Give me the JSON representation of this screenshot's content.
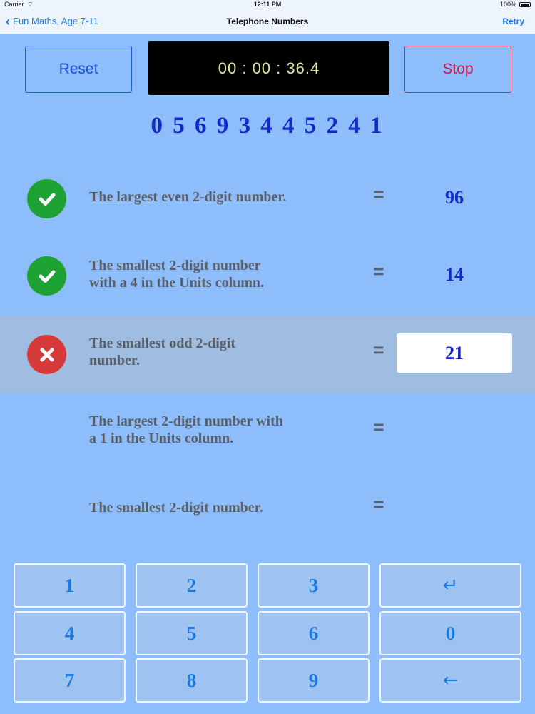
{
  "status_bar": {
    "carrier": "Carrier",
    "time": "12:11 PM",
    "battery": "100%"
  },
  "nav": {
    "back_label": "Fun Maths, Age 7-11",
    "title": "Telephone Numbers",
    "right_label": "Retry"
  },
  "controls": {
    "reset_label": "Reset",
    "stop_label": "Stop",
    "timer": "00 : 00 : 36.4"
  },
  "phone_number": "0 5 6 9 3 4 4 5 2 4 1",
  "questions": [
    {
      "line1": "The largest even 2-digit number.",
      "line2": "",
      "equals": "=",
      "answer": "96",
      "status": "correct"
    },
    {
      "line1": "The smallest 2-digit number",
      "line2": "with a 4 in the Units column.",
      "equals": "=",
      "answer": "14",
      "status": "correct"
    },
    {
      "line1": "The smallest odd 2-digit",
      "line2": "number.",
      "equals": "=",
      "answer": "21",
      "status": "wrong"
    },
    {
      "line1": "The largest 2-digit number with",
      "line2": "a 1 in the Units column.",
      "equals": "=",
      "answer": "",
      "status": "pending"
    },
    {
      "line1": "The smallest 2-digit number.",
      "line2": "",
      "equals": "=",
      "answer": "",
      "status": "pending"
    }
  ],
  "keypad": [
    [
      "1",
      "2",
      "3",
      "↵"
    ],
    [
      "4",
      "5",
      "6",
      "0"
    ],
    [
      "7",
      "8",
      "9",
      "←"
    ]
  ],
  "colors": {
    "background": "#8dbdfb",
    "correct": "#1fa234",
    "wrong": "#d63a3a",
    "answer_text": "#1228c8",
    "accent": "#1a7cf0"
  }
}
